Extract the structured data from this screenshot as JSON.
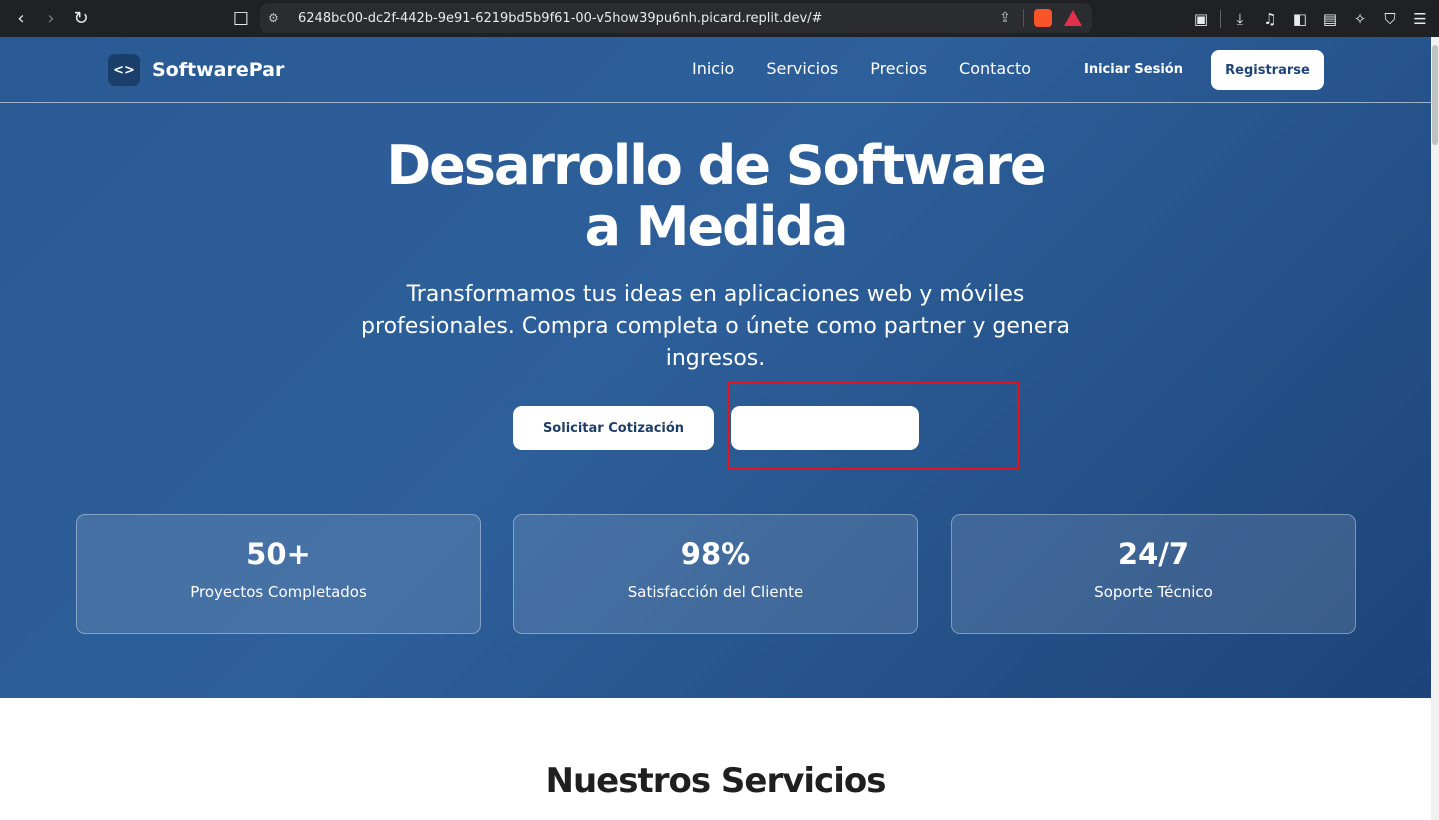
{
  "browser": {
    "url": "6248bc00-dc2f-442b-9e91-6219bd5b9f61-00-v5how39pu6nh.picard.replit.dev/#",
    "back_icon": "‹",
    "forward_icon": "›",
    "reload_icon": "↻",
    "bookmark_icon": "☐",
    "site_settings_icon": "⚙",
    "share_icon": "⇪",
    "tool_icons": [
      "screenshot-icon",
      "download-icon",
      "music-icon",
      "sidebar-icon",
      "wallet-icon",
      "ai-icon",
      "vpn-icon",
      "menu-icon"
    ]
  },
  "site": {
    "brand_logo": "<>",
    "brand_name": "SoftwarePar",
    "nav": [
      "Inicio",
      "Servicios",
      "Precios",
      "Contacto"
    ],
    "login_label": "Iniciar Sesión",
    "register_label": "Registrarse"
  },
  "hero": {
    "title_line1": "Desarrollo de Software",
    "title_line2": "a Medida",
    "subtitle": "Transformamos tus ideas en aplicaciones web y móviles profesionales. Compra completa o únete como partner y genera ingresos.",
    "cta_primary": "Solicitar Cotización",
    "cta_secondary": ""
  },
  "stats": [
    {
      "value": "50+",
      "label": "Proyectos Completados"
    },
    {
      "value": "98%",
      "label": "Satisfacción del Cliente"
    },
    {
      "value": "24/7",
      "label": "Soporte Técnico"
    }
  ],
  "services": {
    "title": "Nuestros Servicios"
  },
  "colors": {
    "hero_bg": "#2a5a94",
    "button_text": "#1e4478",
    "highlight": "#e0141e"
  }
}
